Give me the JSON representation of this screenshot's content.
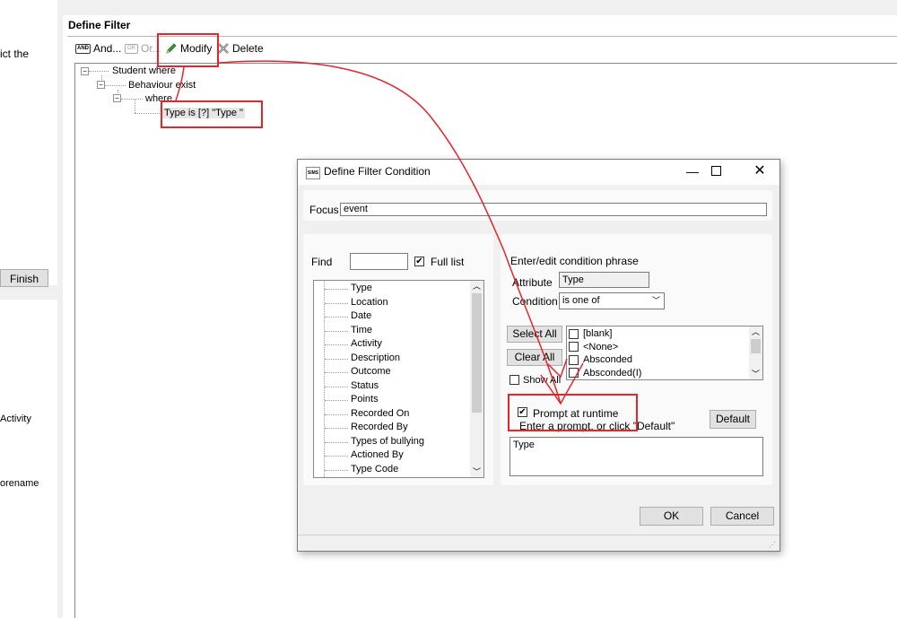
{
  "left": {
    "snippet_top": "ict the",
    "finish_label": "Finish",
    "snippet_activity": "Activity",
    "snippet_forename": "orename"
  },
  "filter": {
    "title": "Define Filter",
    "toolbar": {
      "and_label": "And...",
      "or_label": "Or...",
      "modify_label": "Modify",
      "delete_label": "Delete"
    },
    "tree": {
      "root": "Student where",
      "child": "Behaviour exist",
      "where": "where",
      "condition": "Type is  [?] \"Type \""
    }
  },
  "dialog": {
    "app_icon": "SIMS",
    "title": "Define Filter Condition",
    "focus_label": "Focus",
    "focus_value": "event",
    "find_label": "Find",
    "find_value": "",
    "full_list_label": "Full list",
    "full_list_checked": true,
    "attributes": [
      "Type",
      "Location",
      "Date",
      "Time",
      "Activity",
      "Description",
      "Outcome",
      "Status",
      "Points",
      "Recorded On",
      "Recorded By",
      "Types of bullying",
      "Actioned By",
      "Type Code"
    ],
    "phrase_title": "Enter/edit condition phrase",
    "attribute_label": "Attribute",
    "attribute_value": "Type",
    "condition_label": "Condition",
    "condition_value": "is one of",
    "select_all_label": "Select All",
    "clear_all_label": "Clear All",
    "values": [
      "[blank]",
      "<None>",
      "Absconded",
      "Absconded(I)"
    ],
    "show_all_label": "Show All",
    "prompt_label": "Prompt at runtime",
    "prompt_checked": true,
    "prompt_hint": "Enter a prompt, or click \"Default\"",
    "default_label": "Default",
    "prompt_text": "Type",
    "ok_label": "OK",
    "cancel_label": "Cancel"
  },
  "colors": {
    "annotation": "#e3262b",
    "pencil": "#3b9b3b",
    "delete_x": "#6c6c6c"
  }
}
